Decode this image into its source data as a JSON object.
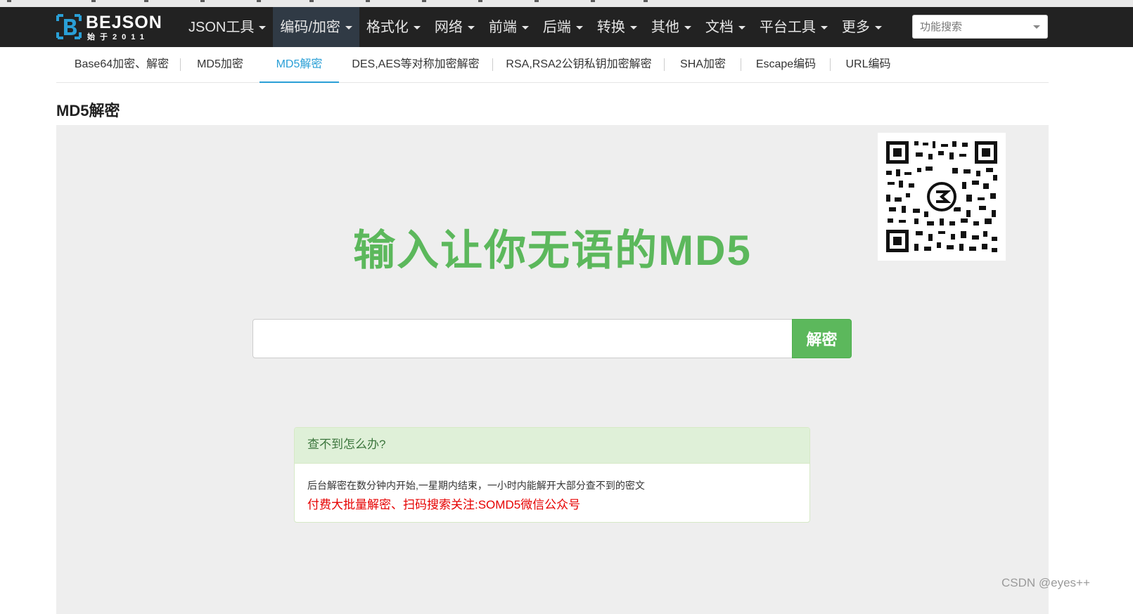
{
  "logo": {
    "brand": "BEJSON",
    "tagline": "始于2011"
  },
  "nav": {
    "items": [
      {
        "label": "JSON工具",
        "active": false
      },
      {
        "label": "编码/加密",
        "active": true
      },
      {
        "label": "格式化",
        "active": false
      },
      {
        "label": "网络",
        "active": false
      },
      {
        "label": "前端",
        "active": false
      },
      {
        "label": "后端",
        "active": false
      },
      {
        "label": "转换",
        "active": false
      },
      {
        "label": "其他",
        "active": false
      },
      {
        "label": "文档",
        "active": false
      },
      {
        "label": "平台工具",
        "active": false
      },
      {
        "label": "更多",
        "active": false
      }
    ],
    "search_placeholder": "功能搜索"
  },
  "subtabs": [
    {
      "label": "Base64加密、解密"
    },
    {
      "label": "MD5加密"
    },
    {
      "label": "MD5解密",
      "active": true
    },
    {
      "label": "DES,AES等对称加密解密"
    },
    {
      "label": "RSA,RSA2公钥私钥加密解密"
    },
    {
      "label": "SHA加密"
    },
    {
      "label": "Escape编码"
    },
    {
      "label": "URL编码"
    }
  ],
  "page": {
    "title": "MD5解密",
    "headline": "输入让你无语的MD5",
    "input_value": "",
    "decrypt_label": "解密"
  },
  "info": {
    "heading": "查不到怎么办?",
    "line1": "后台解密在数分钟内开始,一星期内结束，一小时内能解开大部分查不到的密文",
    "line2": "付费大批量解密、扫码搜索关注:SOMD5微信公众号"
  },
  "watermark": "CSDN @eyes++",
  "colors": {
    "accent_green": "#5cb85c",
    "link_blue": "#2a9fd6",
    "alert_red": "#e60000",
    "navbar": "#222222"
  }
}
